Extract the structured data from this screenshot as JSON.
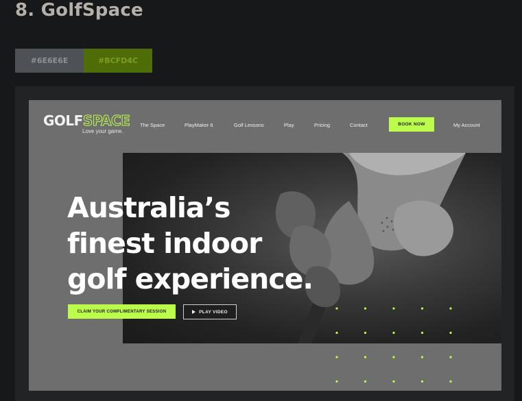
{
  "heading": "8. GolfSpace",
  "swatches": [
    {
      "label": "#6E6E6E",
      "color": "#6E6E6E"
    },
    {
      "label": "#BCFD4C",
      "color": "#BCFD4C"
    }
  ],
  "site": {
    "logo": {
      "golf": "GOLF",
      "space": "SPACE",
      "tagline": "Love your game."
    },
    "nav": {
      "the_space": "The Space",
      "playmaker": "PlayMaker 6",
      "lessons": "Golf Lessons",
      "play": "Play",
      "pricing": "Pricing",
      "contact": "Contact",
      "book_now": "BOOK NOW",
      "account": "My Account"
    },
    "hero": {
      "line1": "Australia’s",
      "line2": "finest indoor",
      "line3": "golf experience.",
      "cta_primary": "CLAIM YOUR COMPLIMENTARY SESSION",
      "cta_video": "PLAY VIDEO"
    }
  },
  "colors": {
    "accent": "#bcfd4c",
    "background": "#6e6e6e"
  },
  "icons": {
    "video": "play-icon"
  }
}
